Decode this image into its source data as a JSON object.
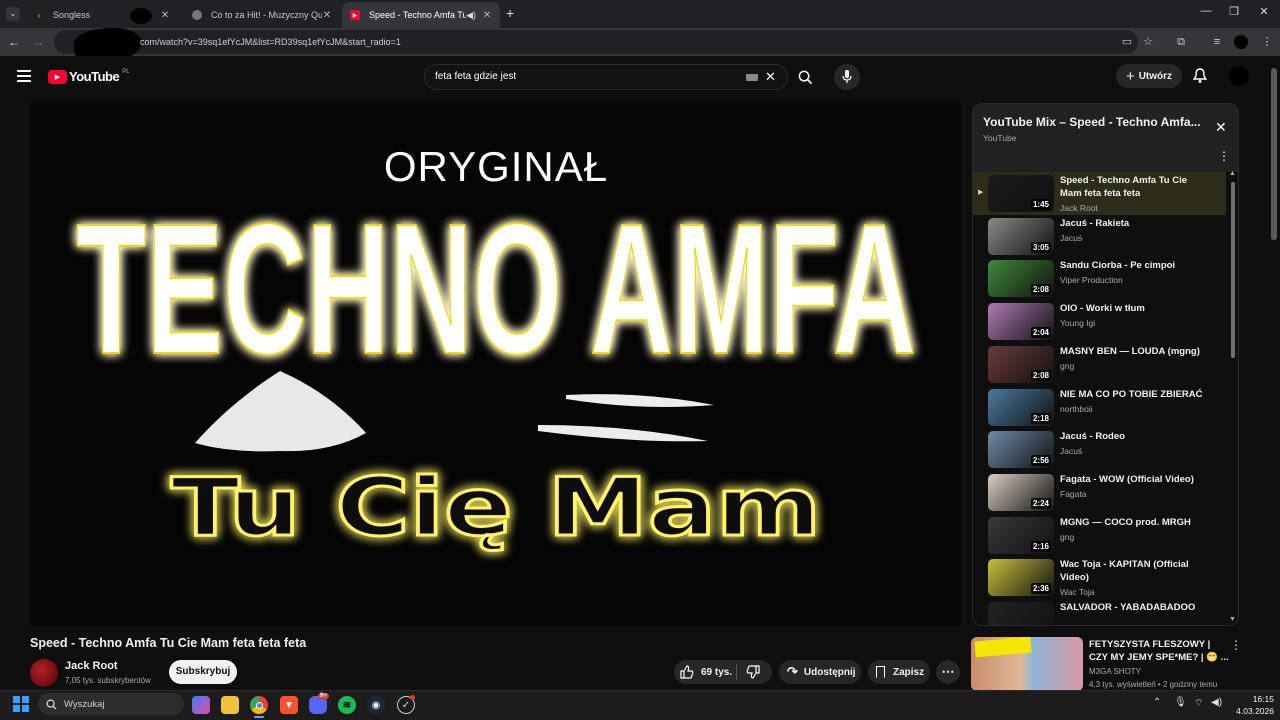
{
  "browser": {
    "tabs": [
      {
        "title": "Songless"
      },
      {
        "title": "Co to za Hit! - Muzyczny Quiz I"
      },
      {
        "title": "Speed - Techno Amfa Tu Cie"
      }
    ],
    "new_tab": "+",
    "url": "com/watch?v=39sq1efYcJM&list=RD39sq1efYcJM&start_radio=1"
  },
  "youtube": {
    "logo_text": "YouTube",
    "region": "PL",
    "search_value": "feta feta gdzie jest",
    "create_label": "Utwórz"
  },
  "video": {
    "line_top": "ORYGINAŁ",
    "line_main": "TECHNO AMFA",
    "line_bottom": "Tu Cię Mam",
    "title": "Speed - Techno Amfa Tu Cie Mam feta feta feta",
    "channel": "Jack Root",
    "subscribers": "7,05 tys. subskrybentów",
    "subscribe_label": "Subskrybuj",
    "likes": "69 tys.",
    "share_label": "Udostępnij",
    "save_label": "Zapisz"
  },
  "playlist": {
    "title": "YouTube Mix – Speed - Techno Amfa...",
    "subtitle": "YouTube",
    "items": [
      {
        "title": "Speed - Techno Amfa Tu Cie Mam feta feta feta",
        "channel": "Jack Root",
        "duration": "1:45",
        "thumb_color": "#1a1a1a"
      },
      {
        "title": "Jacuś - Rakieta",
        "channel": "Jacuś",
        "duration": "3:05",
        "thumb_color": "#8a8a8a"
      },
      {
        "title": "Sandu Ciorba - Pe cimpoi",
        "channel": "Viper Production",
        "duration": "2:08",
        "thumb_color": "#3f8a3a"
      },
      {
        "title": "OIO - Worki w tłum",
        "channel": "Young Igi",
        "duration": "2:04",
        "thumb_color": "#b07ab5"
      },
      {
        "title": "MASNY BEN — LOUDA (mgng)",
        "channel": "gng",
        "duration": "2:08",
        "thumb_color": "#6b3a3a"
      },
      {
        "title": "NIE MA CO PO TOBIE ZBIERAĆ",
        "channel": "northboii",
        "duration": "2:18",
        "thumb_color": "#4a7aa0"
      },
      {
        "title": "Jacuś - Rodeo",
        "channel": "Jacuś",
        "duration": "2:56",
        "thumb_color": "#6d8aa6"
      },
      {
        "title": "Fagata - WOW (Official Video)",
        "channel": "Fagata",
        "duration": "2:24",
        "thumb_color": "#d9cfc2"
      },
      {
        "title": "MGNG — COCO prod. MRGH",
        "channel": "gng",
        "duration": "2:16",
        "thumb_color": "#3a3a3a"
      },
      {
        "title": "Wac Toja - KAPITAN (Official Video)",
        "channel": "Wac Toja",
        "duration": "2:36",
        "thumb_color": "#c8c23a"
      },
      {
        "title": "SALVADOR - YABADABADOO",
        "channel": "",
        "duration": "",
        "thumb_color": "#222222"
      }
    ]
  },
  "recommendation": {
    "title": "FETYSZYSTA FLESZOWY | CZY MY JEMY SPE*ME? | 😁 ...",
    "channel": "M3GA SHOTY",
    "meta": "4,3 tys. wyświetleń • 2 godziny temu"
  },
  "taskbar": {
    "search_placeholder": "Wyszukaj",
    "time": "16:15",
    "date": "4.03.2026",
    "discord_badge": "9+"
  },
  "colors": {
    "accent_red": "#ff0033",
    "glow_yellow": "#e8d300"
  }
}
